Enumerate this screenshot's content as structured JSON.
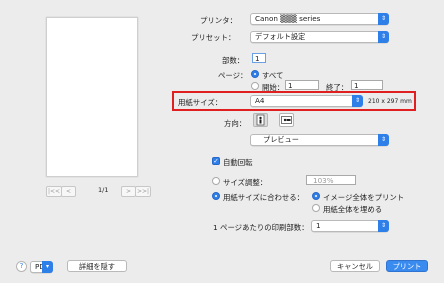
{
  "preview": {
    "nav_first": "|<<",
    "nav_prev": "<",
    "page_indicator": "1/1",
    "nav_next": ">",
    "nav_last": ">>|"
  },
  "printer": {
    "label": "プリンタ：",
    "value": "Canon ▒▒▒ series"
  },
  "presets": {
    "label": "プリセット：",
    "value": "デフォルト設定"
  },
  "copies": {
    "label": "部数：",
    "value": "1"
  },
  "pages": {
    "label": "ページ：",
    "all_label": "すべて",
    "from_label": "開始：",
    "from_value": "1",
    "to_label": "終了：",
    "to_value": "1"
  },
  "paper_size": {
    "label": "用紙サイズ：",
    "value": "A4",
    "dimensions": "210 x 297 mm"
  },
  "orientation": {
    "label": "方向："
  },
  "section_popup": {
    "value": "プレビュー"
  },
  "auto_rotate": {
    "label": "自動回転"
  },
  "scale": {
    "label": "サイズ調整：",
    "value": "103%"
  },
  "scale_to_fit": {
    "label": "用紙サイズに合わせる：",
    "print_entire": "イメージ全体をプリント",
    "fill_paper": "用紙全体を埋める"
  },
  "copies_per_page": {
    "label": "1 ページあたりの印刷部数：",
    "value": "1"
  },
  "footer": {
    "help": "?",
    "pdf": "PDF",
    "hide_details": "詳細を隠す",
    "cancel": "キャンセル",
    "print": "プリント"
  },
  "colors": {
    "accent": "#2f7fe9",
    "highlight": "#e02020"
  }
}
